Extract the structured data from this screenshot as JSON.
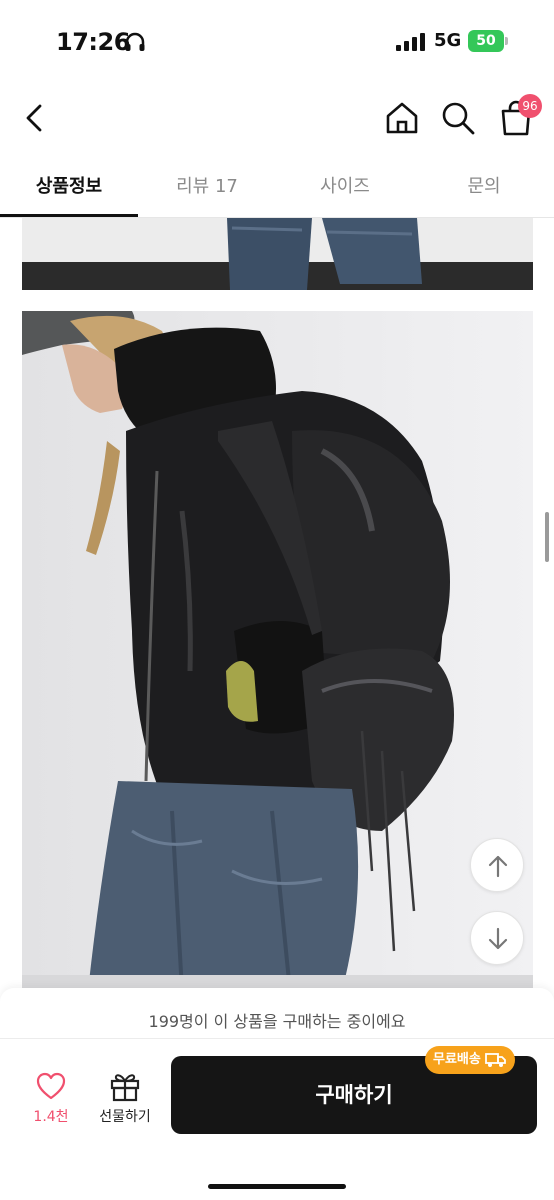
{
  "status_bar": {
    "time": "17:26",
    "network": "5G",
    "battery": "50",
    "icons": [
      "headphones-icon",
      "signal-icon",
      "battery-icon"
    ]
  },
  "header": {
    "icons": [
      "back-arrow-icon",
      "home-icon",
      "search-icon",
      "cart-icon"
    ],
    "cart_badge": "96"
  },
  "tabs": [
    {
      "label": "상품정보",
      "active": true
    },
    {
      "label": "리뷰 17",
      "active": false
    },
    {
      "label": "사이즈",
      "active": false
    },
    {
      "label": "문의",
      "active": false
    }
  ],
  "bottom": {
    "purchase_notice": "199명이 이 상품을 구매하는 중이에요",
    "like_count": "1.4천",
    "gift_label": "선물하기",
    "buy_label": "구매하기",
    "free_shipping": "무료배송"
  },
  "colors": {
    "accent_pink": "#f0506e",
    "buy_button": "#151515",
    "shipping_badge": "#f7a21b",
    "battery": "#34c759"
  }
}
